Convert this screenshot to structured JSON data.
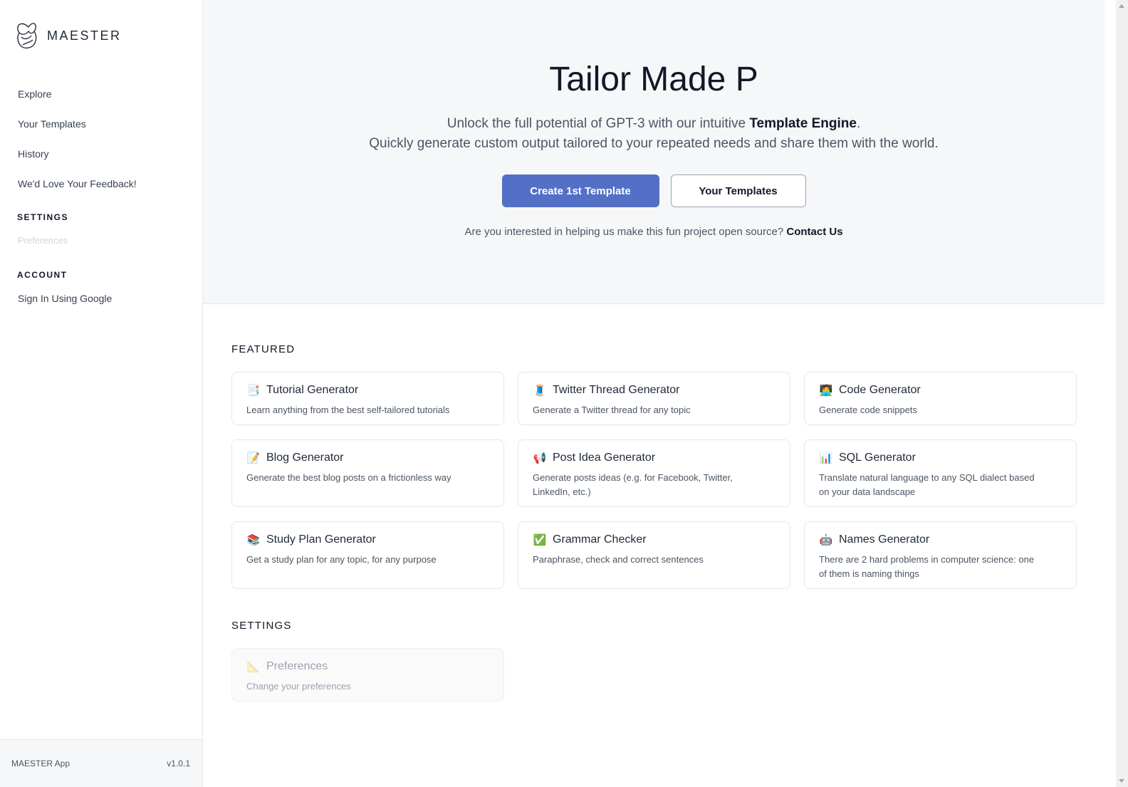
{
  "brand": {
    "name": "MAESTER",
    "logo_icon": "maester-logo-icon"
  },
  "sidebar": {
    "nav": [
      {
        "label": "Explore"
      },
      {
        "label": "Your Templates"
      },
      {
        "label": "History"
      },
      {
        "label": "We'd Love Your Feedback!"
      }
    ],
    "settings_title": "SETTINGS",
    "settings_items": [
      {
        "label": "Preferences",
        "disabled": true
      }
    ],
    "account_title": "ACCOUNT",
    "account_items": [
      {
        "label": "Sign In Using Google"
      }
    ],
    "footer": {
      "app_name": "MAESTER App",
      "version": "v1.0.1"
    }
  },
  "hero": {
    "title": "Tailor Made P",
    "subtitle_line1_prefix": "Unlock the full potential of GPT-3 with our intuitive ",
    "subtitle_line1_bold": "Template Engine",
    "subtitle_line1_suffix": ".",
    "subtitle_line2": "Quickly generate custom output tailored to your repeated needs and share them with the world.",
    "primary_button": "Create 1st Template",
    "secondary_button": "Your Templates",
    "note_text": "Are you interested in helping us make this fun project open source? ",
    "note_link": "Contact Us",
    "accent_color": "#5470c6"
  },
  "featured": {
    "title": "FEATURED",
    "cards": [
      {
        "icon": "📑",
        "icon_name": "document-icon",
        "title": "Tutorial Generator",
        "desc": "Learn anything from the best self-tailored tutorials"
      },
      {
        "icon": "🧵",
        "icon_name": "thread-icon",
        "title": "Twitter Thread Generator",
        "desc": "Generate a Twitter thread for any topic"
      },
      {
        "icon": "🧑‍💻",
        "icon_name": "technologist-icon",
        "title": "Code Generator",
        "desc": "Generate code snippets"
      },
      {
        "icon": "📝",
        "icon_name": "memo-icon",
        "title": "Blog Generator",
        "desc": "Generate the best blog posts on a frictionless way"
      },
      {
        "icon": "📢",
        "icon_name": "megaphone-icon",
        "title": "Post Idea Generator",
        "desc": "Generate posts ideas (e.g. for Facebook, Twitter, LinkedIn, etc.)"
      },
      {
        "icon": "📊",
        "icon_name": "bar-chart-icon",
        "title": "SQL Generator",
        "desc": "Translate natural language to any SQL dialect based on your data landscape"
      },
      {
        "icon": "📚",
        "icon_name": "books-icon",
        "title": "Study Plan Generator",
        "desc": "Get a study plan for any topic, for any purpose"
      },
      {
        "icon": "✅",
        "icon_name": "check-mark-icon",
        "title": "Grammar Checker",
        "desc": "Paraphrase, check and correct sentences"
      },
      {
        "icon": "🤖",
        "icon_name": "robot-icon",
        "title": "Names Generator",
        "desc": "There are 2 hard problems in computer science: one of them is naming things"
      }
    ]
  },
  "settings": {
    "title": "SETTINGS",
    "cards": [
      {
        "icon": "📐",
        "icon_name": "triangular-ruler-icon",
        "title": "Preferences",
        "desc": "Change your preferences",
        "disabled": true
      }
    ]
  }
}
